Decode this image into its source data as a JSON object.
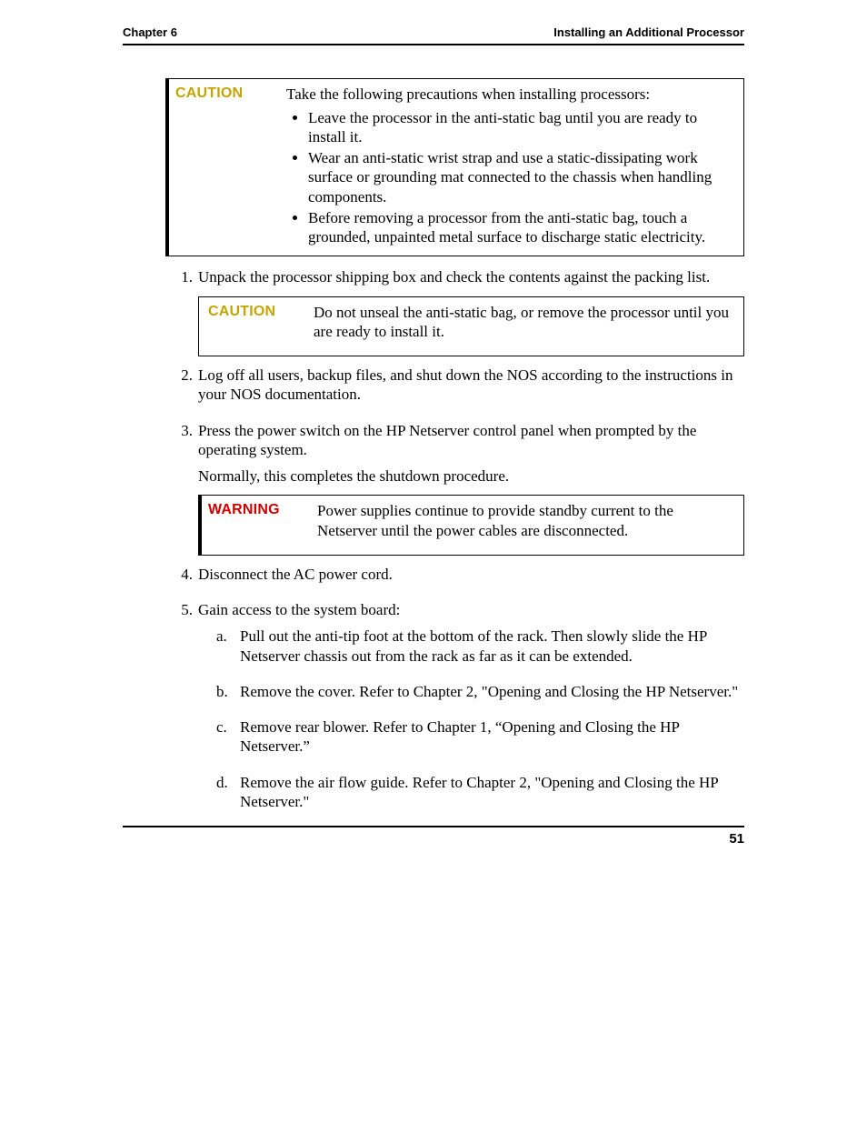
{
  "header": {
    "left": "Chapter 6",
    "right": "Installing an Additional Processor"
  },
  "caution_box": {
    "label": "CAUTION",
    "intro": "Take the following precautions when installing processors:",
    "bullets": [
      "Leave the processor in the anti-static bag until you are ready to install it.",
      "Wear an anti-static wrist strap and use a static-dissipating work surface or grounding mat connected to the chassis when handling components.",
      "Before removing a processor from the anti-static bag, touch a grounded, unpainted metal surface to discharge static electricity."
    ]
  },
  "steps_part1": {
    "s1": {
      "marker": "1.",
      "text": "Unpack the processor shipping box and check the contents against the packing list."
    }
  },
  "caution_inline": {
    "label": "CAUTION",
    "text": "Do not unseal the anti-static bag, or remove the processor until you are ready to install it."
  },
  "steps_part2": {
    "s2": {
      "marker": "2.",
      "text": "Log off all users, backup files, and shut down the NOS according to the instructions in your NOS documentation."
    },
    "s3": {
      "marker": "3.",
      "text": "Press the power switch on the HP Netserver control panel when prompted by the operating system.",
      "text2": "Normally, this completes the shutdown procedure."
    }
  },
  "warning_inline": {
    "label": "WARNING",
    "text": "Power supplies continue to provide standby current to the Netserver until the power cables are disconnected."
  },
  "steps_part3": {
    "s4": {
      "marker": "4.",
      "text": "Disconnect the AC power cord."
    },
    "s5": {
      "marker": "5.",
      "text": "Gain access to the system board:"
    }
  },
  "substeps": {
    "a": {
      "marker": "a.",
      "text": "Pull out the anti-tip foot at the bottom of the rack. Then slowly slide the HP Netserver chassis out from the rack as far as it can be extended."
    },
    "b": {
      "marker": "b.",
      "text": "Remove the cover. Refer to Chapter 2, \"Opening and Closing the HP Netserver.\""
    },
    "c": {
      "marker": "c.",
      "text": "Remove rear blower.  Refer to Chapter 1, “Opening and Closing the HP Netserver.”"
    },
    "d": {
      "marker": "d.",
      "text": "Remove the air flow guide.  Refer to Chapter 2, \"Opening and Closing the HP Netserver.\""
    }
  },
  "footer": {
    "page_number": "51"
  }
}
